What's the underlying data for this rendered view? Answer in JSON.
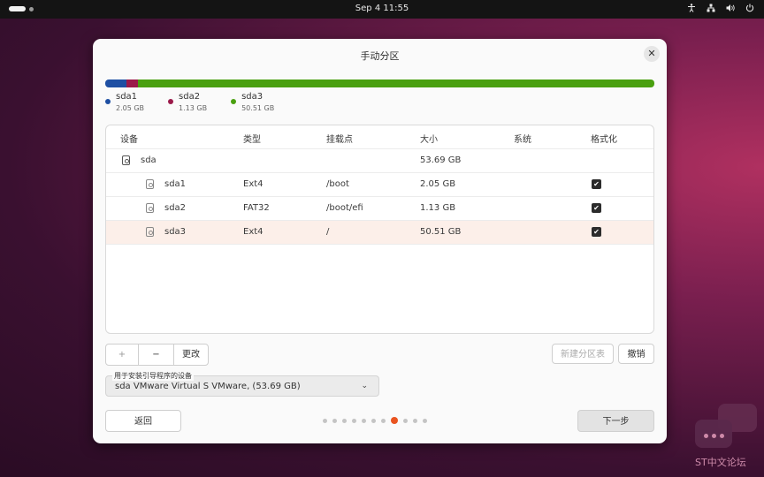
{
  "topbar": {
    "clock": "Sep 4  11:55"
  },
  "dialog": {
    "title": "手动分区",
    "close_icon": "✕",
    "usage_bar": [
      {
        "name": "sda1",
        "size": "2.05 GB",
        "fraction": 0.038,
        "color": "#1e4fa3"
      },
      {
        "name": "sda2",
        "size": "1.13 GB",
        "fraction": 0.021,
        "color": "#9b1a4a"
      },
      {
        "name": "sda3",
        "size": "50.51 GB",
        "fraction": 0.941,
        "color": "#4aa010"
      }
    ],
    "table": {
      "columns": [
        "设备",
        "类型",
        "挂载点",
        "大小",
        "系统",
        "格式化"
      ],
      "disk": {
        "device": "sda",
        "size": "53.69 GB"
      },
      "partitions": [
        {
          "device": "sda1",
          "type": "Ext4",
          "mount": "/boot",
          "size": "2.05 GB",
          "format": true
        },
        {
          "device": "sda2",
          "type": "FAT32",
          "mount": "/boot/efi",
          "size": "1.13 GB",
          "format": true
        },
        {
          "device": "sda3",
          "type": "Ext4",
          "mount": "/",
          "size": "50.51 GB",
          "format": true
        }
      ],
      "checkmark": "✔"
    },
    "toolbar": {
      "add_label": "+",
      "remove_label": "−",
      "change_label": "更改",
      "new_table_label": "新建分区表",
      "revert_label": "撤销"
    },
    "bootloader": {
      "label": "用于安装引导程序的设备",
      "value": "sda VMware Virtual S VMware, (53.69 GB)",
      "chevron": "⌄"
    },
    "nav": {
      "back_label": "返回",
      "next_label": "下一步",
      "page_count": 11,
      "current_page": 8
    }
  },
  "watermark": {
    "text": "ST中文论坛"
  }
}
